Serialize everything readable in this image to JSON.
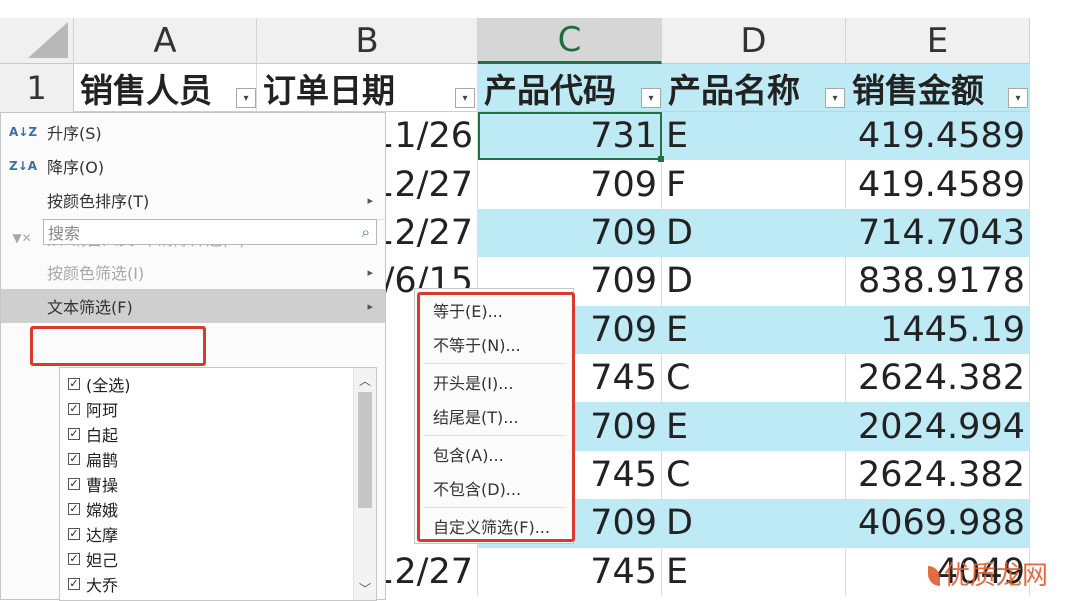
{
  "columns": [
    "A",
    "B",
    "C",
    "D",
    "E"
  ],
  "row_numbers": [
    "1"
  ],
  "headers": [
    "销售人员",
    "订单日期",
    "产品代码",
    "产品名称",
    "销售金额"
  ],
  "rows": [
    {
      "b": "11/26",
      "c": "731",
      "d": "E",
      "e": "419.4589"
    },
    {
      "b": "12/27",
      "c": "709",
      "d": "F",
      "e": "419.4589"
    },
    {
      "b": "12/27",
      "c": "709",
      "d": "D",
      "e": "714.7043"
    },
    {
      "b": "/6/15",
      "c": "709",
      "d": "D",
      "e": "838.9178"
    },
    {
      "b": "",
      "c": "709",
      "d": "E",
      "e": "1445.19"
    },
    {
      "b": "",
      "c": "745",
      "d": "C",
      "e": "2624.382"
    },
    {
      "b": "",
      "c": "709",
      "d": "E",
      "e": "2024.994"
    },
    {
      "b": "",
      "c": "745",
      "d": "C",
      "e": "2624.382"
    },
    {
      "b": "",
      "c": "709",
      "d": "D",
      "e": "4069.988"
    },
    {
      "b": "12/27",
      "c": "745",
      "d": "E",
      "e": "4049"
    }
  ],
  "filter_button_glyph": "▾",
  "menu": {
    "sort_asc": "升序(S)",
    "sort_desc": "降序(O)",
    "sort_by_color": "按颜色排序(T)",
    "clear_filter": "从\"销售人员\"中清除筛选(C)",
    "filter_by_color": "按颜色筛选(I)",
    "text_filter": "文本筛选(F)",
    "search_placeholder": "搜索",
    "submenu_arrow": "▸",
    "icon_asc": "A↓Z",
    "icon_desc": "Z↓A",
    "icon_clear": "▼✕",
    "icon_search": "⌕"
  },
  "filter_items": [
    {
      "label": "(全选)",
      "checked": true
    },
    {
      "label": "阿珂",
      "checked": true
    },
    {
      "label": "白起",
      "checked": true
    },
    {
      "label": "扁鹊",
      "checked": true
    },
    {
      "label": "曹操",
      "checked": true
    },
    {
      "label": "嫦娥",
      "checked": true
    },
    {
      "label": "达摩",
      "checked": true
    },
    {
      "label": "妲己",
      "checked": true
    },
    {
      "label": "大乔",
      "checked": true
    }
  ],
  "check_glyph": "✓",
  "submenu": [
    "等于(E)...",
    "不等于(N)...",
    "开头是(I)...",
    "结尾是(T)...",
    "包含(A)...",
    "不包含(D)...",
    "自定义筛选(F)..."
  ],
  "scroll": {
    "up": "︿",
    "down": "﹀"
  },
  "watermark": "优质龙网",
  "colors": {
    "band": "#bdeaf4",
    "accent": "#217346",
    "highlight_box": "#d93a2e"
  }
}
